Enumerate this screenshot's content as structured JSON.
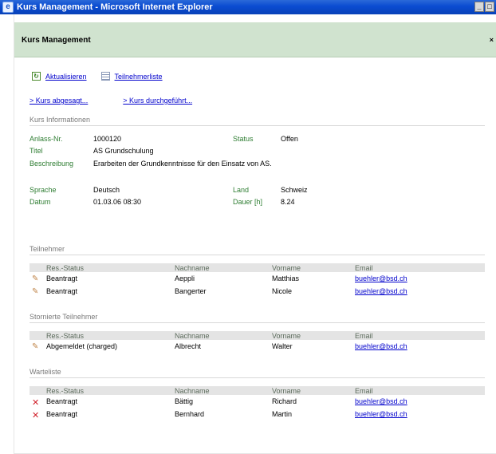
{
  "window": {
    "title": "Kurs Management - Microsoft Internet Explorer",
    "minimize": "_",
    "maximize": "□"
  },
  "dialog": {
    "title": "Kurs Management",
    "close": "×"
  },
  "toolbar": {
    "refresh_label": "Aktualisieren",
    "list_label": "Teilnehmerliste"
  },
  "actions": {
    "cancelled_link": "> Kurs abgesagt...",
    "done_link": "> Kurs durchgeführt..."
  },
  "course_info": {
    "section_title": "Kurs Informationen",
    "anlass_label": "Anlass-Nr.",
    "anlass_value": "1000120",
    "status_label": "Status",
    "status_value": "Offen",
    "titel_label": "Titel",
    "titel_value": "AS Grundschulung",
    "beschreibung_label": "Beschreibung",
    "beschreibung_value": "Erarbeiten der Grundkenntnisse für den Einsatz von AS.",
    "sprache_label": "Sprache",
    "sprache_value": "Deutsch",
    "land_label": "Land",
    "land_value": "Schweiz",
    "datum_label": "Datum",
    "datum_value": "01.03.06 08:30",
    "dauer_label": "Dauer [h]",
    "dauer_value": "8.24"
  },
  "columns": {
    "status": "Res.-Status",
    "nachname": "Nachname",
    "vorname": "Vorname",
    "email": "Email"
  },
  "teilnehmer": {
    "section_title": "Teilnehmer",
    "rows": [
      {
        "icon": "pencil-icon",
        "status": "Beantragt",
        "nachname": "Aeppli",
        "vorname": "Matthias",
        "email": "buehler@bsd.ch"
      },
      {
        "icon": "pencil-icon",
        "status": "Beantragt",
        "nachname": "Bangerter",
        "vorname": "Nicole",
        "email": "buehler@bsd.ch"
      }
    ]
  },
  "storniert": {
    "section_title": "Stornierte Teilnehmer",
    "rows": [
      {
        "icon": "pencil-icon",
        "status": "Abgemeldet (charged)",
        "nachname": "Albrecht",
        "vorname": "Walter",
        "email": "buehler@bsd.ch"
      }
    ]
  },
  "warteliste": {
    "section_title": "Warteliste",
    "rows": [
      {
        "icon": "delete-icon",
        "status": "Beantragt",
        "nachname": "Bättig",
        "vorname": "Richard",
        "email": "buehler@bsd.ch"
      },
      {
        "icon": "delete-icon",
        "status": "Beantragt",
        "nachname": "Bernhard",
        "vorname": "Martin",
        "email": "buehler@bsd.ch"
      }
    ]
  }
}
